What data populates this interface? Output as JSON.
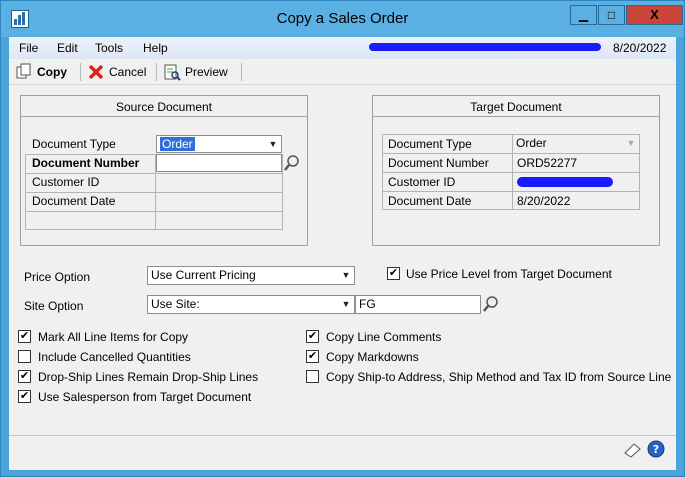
{
  "window": {
    "title": "Copy a Sales Order",
    "minimize": "▁",
    "restore": "□",
    "close": "X"
  },
  "menu": {
    "items": [
      "File",
      "Edit",
      "Tools",
      "Help"
    ],
    "date": "8/20/2022"
  },
  "toolbar": {
    "copy": "Copy",
    "cancel": "Cancel",
    "preview": "Preview"
  },
  "source": {
    "title": "Source Document",
    "doc_type_label": "Document Type",
    "doc_type_value": "Order",
    "doc_number_label": "Document Number",
    "doc_number_value": "",
    "customer_id_label": "Customer ID",
    "doc_date_label": "Document Date"
  },
  "target": {
    "title": "Target Document",
    "doc_type_label": "Document Type",
    "doc_type_value": "Order",
    "doc_number_label": "Document Number",
    "doc_number_value": "ORD52277",
    "customer_id_label": "Customer ID",
    "doc_date_label": "Document Date",
    "doc_date_value": "8/20/2022"
  },
  "options": {
    "price_option_label": "Price Option",
    "price_option_value": "Use Current Pricing",
    "use_price_level_label": "Use Price Level from Target Document",
    "use_price_level_checked": true,
    "site_option_label": "Site Option",
    "site_option_value": "Use Site:",
    "site_value": "FG"
  },
  "checkboxes_left": [
    {
      "label": "Mark All Line Items for Copy",
      "checked": true
    },
    {
      "label": "Include Cancelled Quantities",
      "checked": false
    },
    {
      "label": "Drop-Ship Lines Remain Drop-Ship Lines",
      "checked": true
    },
    {
      "label": "Use Salesperson from Target Document",
      "checked": true
    }
  ],
  "checkboxes_right": [
    {
      "label": "Copy Line Comments",
      "checked": true
    },
    {
      "label": "Copy Markdowns",
      "checked": true
    },
    {
      "label": "Copy Ship-to Address, Ship Method and Tax ID from Source Line",
      "checked": false
    }
  ],
  "colors": {
    "titlebar": "#5ab0e2",
    "close": "#c9453a",
    "selection": "#2f6fd6"
  }
}
